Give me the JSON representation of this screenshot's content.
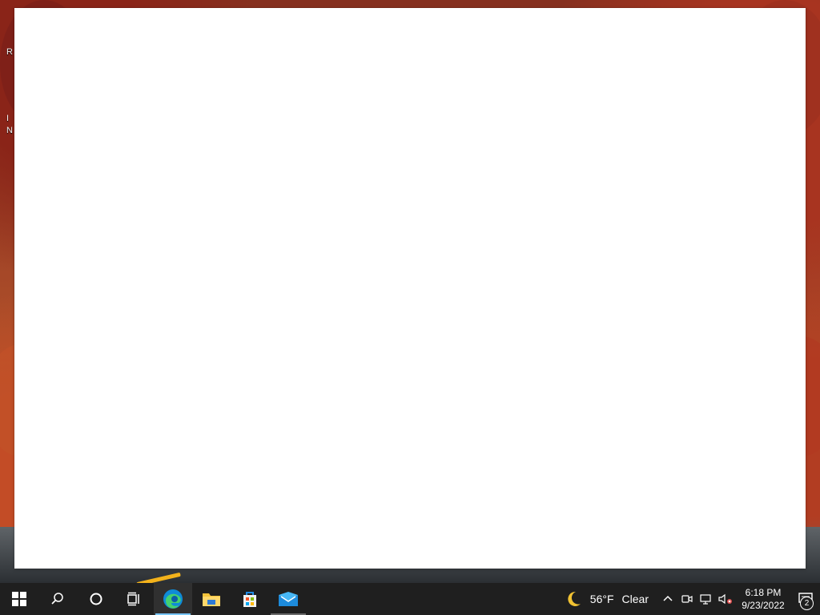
{
  "desktop": {
    "fragments": [
      "R",
      "I",
      "N"
    ]
  },
  "window": {
    "state": "blank"
  },
  "taskbar": {
    "start_icon": "windows-start-icon",
    "search_icon": "search-icon",
    "cortana_icon": "cortana-icon",
    "task_view_icon": "task-view-icon",
    "apps": [
      {
        "name": "Microsoft Edge",
        "icon": "edge-icon",
        "state": "active"
      },
      {
        "name": "File Explorer",
        "icon": "folder-icon",
        "state": "idle"
      },
      {
        "name": "Microsoft Store",
        "icon": "store-icon",
        "state": "idle"
      },
      {
        "name": "Mail",
        "icon": "mail-icon",
        "state": "running"
      }
    ],
    "weather": {
      "icon": "moon-icon",
      "temperature": "56°F",
      "condition": "Clear"
    },
    "tray": {
      "chevron_icon": "chevron-up-icon",
      "meet_icon": "meet-now-icon",
      "network_icon": "network-icon",
      "volume_icon": "volume-muted-icon"
    },
    "clock": {
      "time": "6:18 PM",
      "date": "9/23/2022"
    },
    "notifications": {
      "icon": "notification-center-icon",
      "count": "2"
    }
  },
  "colors": {
    "taskbar": "#1f1f1f",
    "active_indicator": "#78c6ff",
    "window": "#ffffff"
  }
}
